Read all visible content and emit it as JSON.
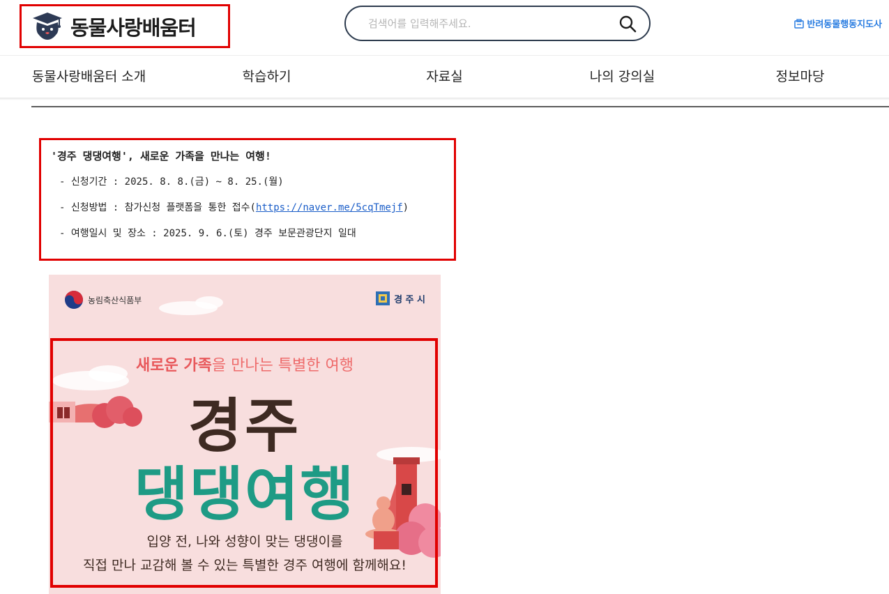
{
  "header": {
    "logo_text": "동물사랑배움터",
    "search_placeholder": "검색어를 입력해주세요.",
    "map_link": "반려동물행동지도사"
  },
  "nav": {
    "items": [
      "동물사랑배움터 소개",
      "학습하기",
      "자료실",
      "나의 강의실",
      "정보마당"
    ]
  },
  "notice": {
    "title": "'경주 댕댕여행', 새로운 가족을 만나는 여행!",
    "period": "- 신청기간 : 2025. 8. 8.(금) ~ 8. 25.(월)",
    "method_prefix": "- 신청방법 : 참가신청 플랫폼을 통한 접수(",
    "method_link": "https://naver.me/5cqTmejf",
    "method_suffix": ")",
    "place": "- 여행일시 및 장소 : 2025. 9. 6.(토) 경주 보문관광단지 일대"
  },
  "poster": {
    "ministry": "농림축산식품부",
    "city": "경 주 시",
    "subtitle_highlight": "새로운 가족",
    "subtitle_rest": "을 만나는 특별한 여행",
    "title_line1": "경주",
    "title_line2": "댕댕여행",
    "desc_line1": "입양 전, 나와 성향이 맞는 댕댕이를",
    "desc_line2": "직접 만나 교감해 볼 수 있는 특별한 경주 여행에 함께해요!"
  },
  "colors": {
    "highlight_box": "#e10000",
    "poster_bg": "#f8dede",
    "title_brown": "#3e2a22",
    "title_teal": "#1e9b85",
    "accent_pink": "#e8585b",
    "link_blue": "#2a7de1"
  }
}
